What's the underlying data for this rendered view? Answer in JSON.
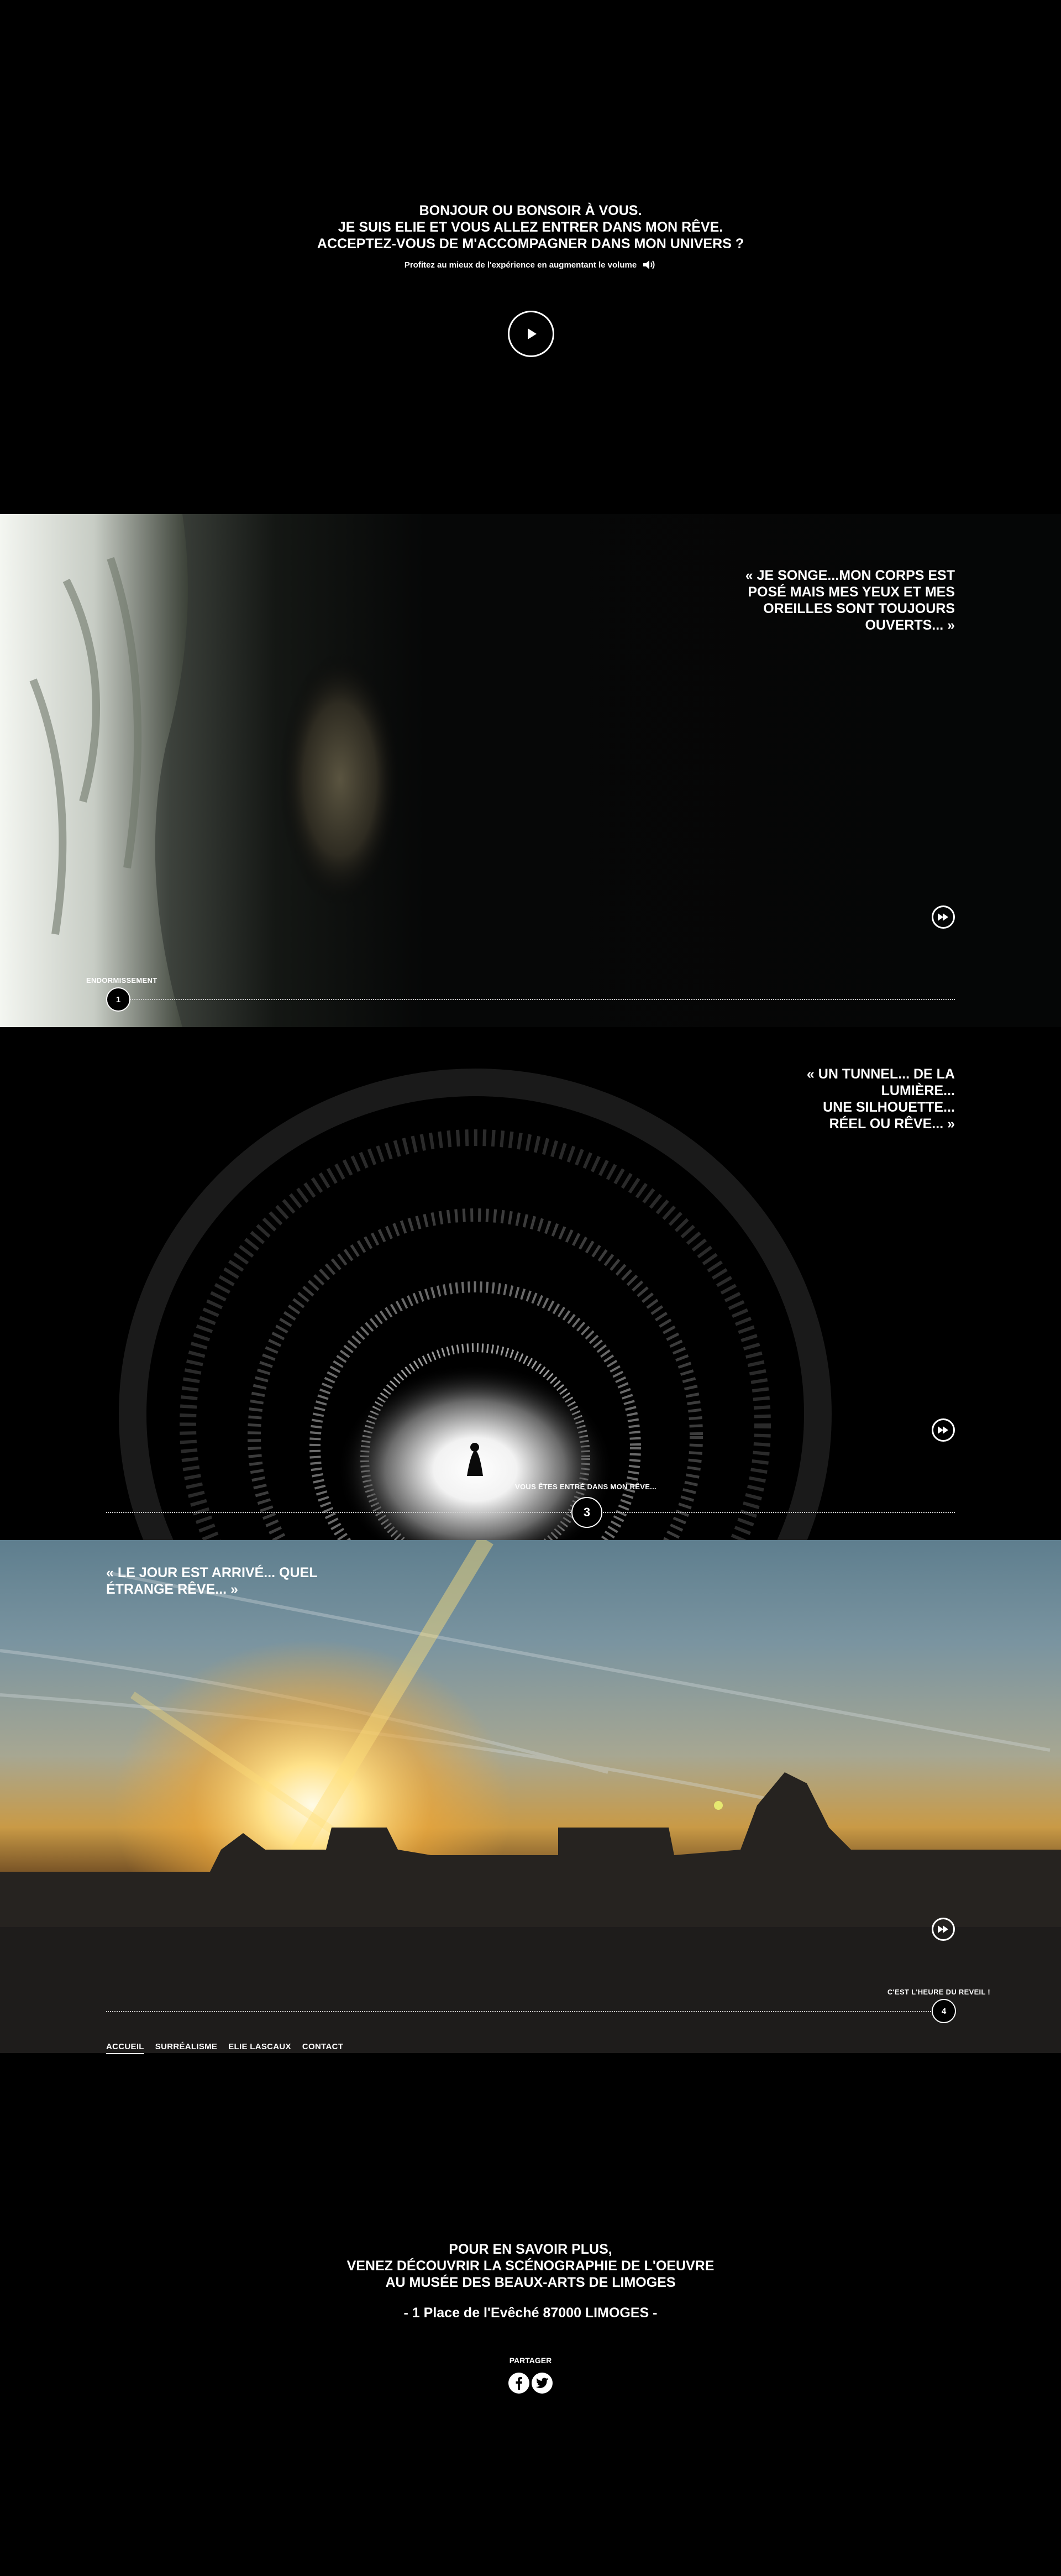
{
  "nav": {
    "items": [
      {
        "label": "ACCUEIL",
        "active": true
      },
      {
        "label": "SURRÉALISME",
        "active": false
      },
      {
        "label": "ELIE LASCAUX",
        "active": false
      },
      {
        "label": "CONTACT",
        "active": false
      }
    ]
  },
  "intro": {
    "lines": [
      "BONJOUR OU BONSOIR À VOUS.",
      "JE SUIS ELIE ET VOUS ALLEZ ENTRER DANS MON RÊVE.",
      "ACCEPTEZ-VOUS DE M'ACCOMPAGNER DANS MON UNIVERS ?"
    ],
    "volume_hint": "Profitez au mieux de l'expérience en augmentant le volume",
    "volume_icon": "speaker-icon",
    "play_icon": "play-icon"
  },
  "scenes": [
    {
      "quote_lines": [
        "« JE SONGE...MON CORPS EST",
        "POSÉ MAIS MES YEUX ET MES",
        "OREILLES SONT TOUJOURS",
        "OUVERTS... »"
      ],
      "step_number": "1",
      "step_label": "ENDORMISSEMENT",
      "next_icon": "fast-forward-icon"
    },
    {
      "quote_lines": [
        "« UN TUNNEL... DE LA",
        "LUMIÈRE...",
        "UNE SILHOUETTE...",
        "RÉEL OU RÊVE... »"
      ],
      "step_number": "3",
      "step_label": "VOUS ÊTES ENTRÉ DANS MON RÊVE...",
      "next_icon": "fast-forward-icon"
    },
    {
      "quote_lines": [
        "« LE JOUR EST ARRIVÉ... QUEL",
        "ÉTRANGE RÊVE... »"
      ],
      "step_number": "4",
      "step_label": "C'EST L'HEURE DU REVEIL !",
      "next_icon": "fast-forward-icon"
    }
  ],
  "footer": {
    "lines": [
      "POUR EN SAVOIR PLUS,",
      "VENEZ DÉCOUVRIR LA SCÉNOGRAPHIE DE L'OEUVRE",
      "AU MUSÉE DES BEAUX-ARTS DE LIMOGES"
    ],
    "address": "- 1 Place de l'Evêché 87000 LIMOGES -",
    "share_label": "PARTAGER",
    "share_icons": [
      "facebook-icon",
      "twitter-icon"
    ]
  },
  "colors": {
    "background": "#000000",
    "text": "#ffffff"
  }
}
